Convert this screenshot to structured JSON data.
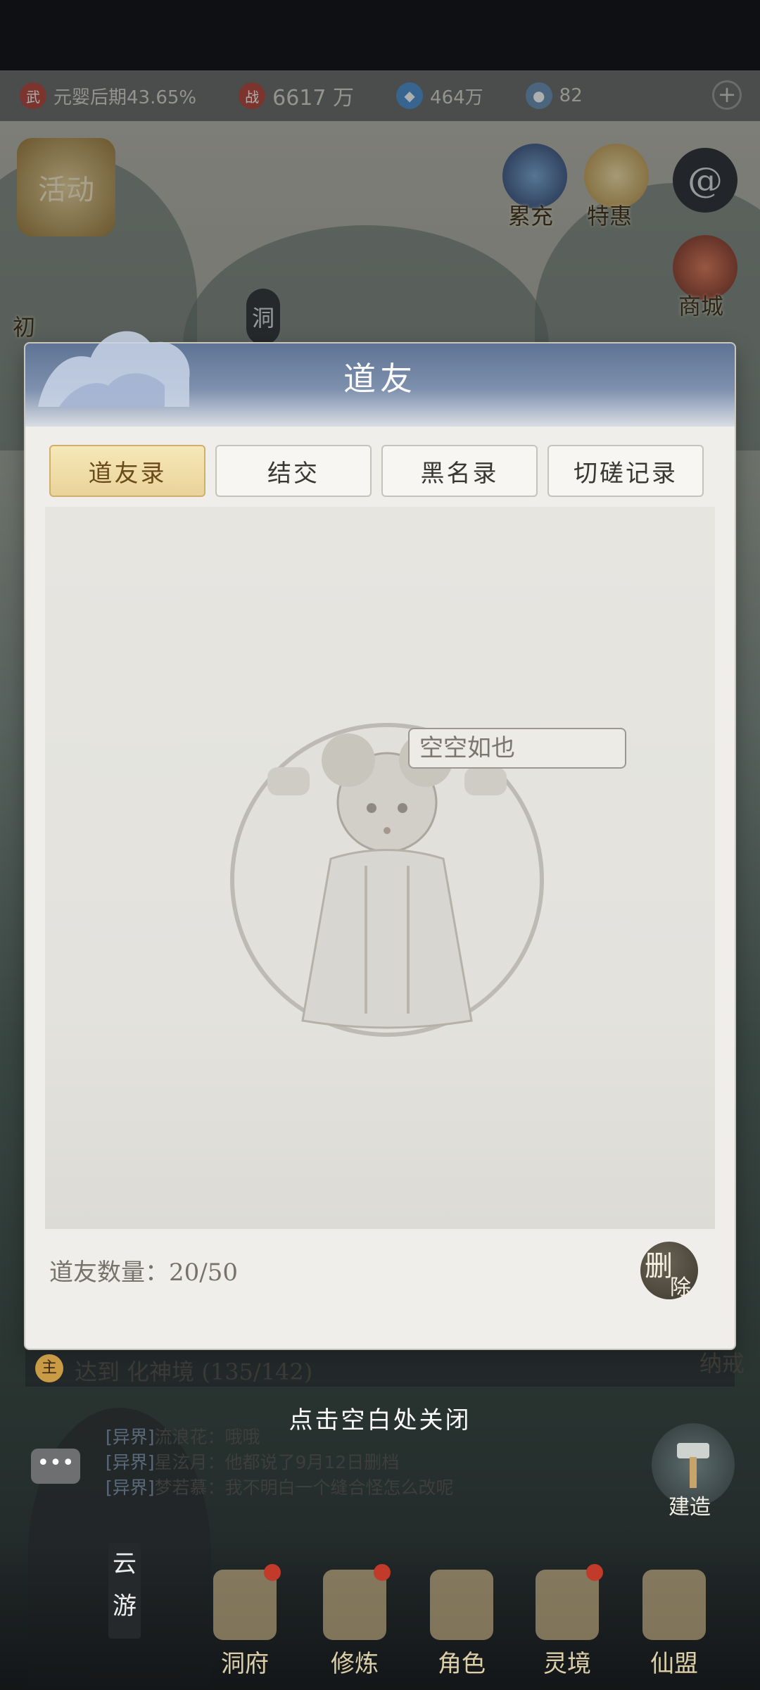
{
  "resources": [
    {
      "icon": "cultivation-icon",
      "glyph": "武",
      "color": "#b2453a",
      "text": "元婴后期43.65%"
    },
    {
      "icon": "combat-power-icon",
      "glyph": "战",
      "color": "#b2453a",
      "text": "6617 万"
    },
    {
      "icon": "spirit-stone-icon",
      "glyph": "◆",
      "color": "#4b8fd0",
      "text": "464万"
    },
    {
      "icon": "gem-icon",
      "glyph": "●",
      "color": "#6a8fb5",
      "text": "82"
    }
  ],
  "side_buttons": {
    "activity": "活动",
    "recharge": "累充",
    "special_offer": "特惠",
    "shop": "商城",
    "first_charge": "初",
    "cave_tag": "洞"
  },
  "modal": {
    "title": "道友",
    "tabs": [
      {
        "label": "道友录",
        "active": true
      },
      {
        "label": "结交",
        "active": false
      },
      {
        "label": "黑名录",
        "active": false
      },
      {
        "label": "切磋记录",
        "active": false
      }
    ],
    "empty_message": "空空如也",
    "friend_count_label": "道友数量：20/50",
    "delete_label_1": "删",
    "delete_label_2": "除"
  },
  "quest": {
    "icon_glyph": "主",
    "text": "达到 化神境 (135/142)"
  },
  "storage_label": "纳戒",
  "close_hint": "点击空白处关闭",
  "chat": {
    "button_glyph": "•••",
    "lines": [
      {
        "tag": "[异界]",
        "text": "流浪花：哦哦"
      },
      {
        "tag": "[异界]",
        "text": "星泫月：他都说了9月12日删档"
      },
      {
        "tag": "[异界]",
        "text": "梦若慕：我不明白一个缝合怪怎么改呢"
      }
    ]
  },
  "build_label": "建造",
  "yunyou_label": "云游",
  "bottom_nav": [
    {
      "label": "洞府",
      "has_dot": true
    },
    {
      "label": "修炼",
      "has_dot": true
    },
    {
      "label": "角色",
      "has_dot": false
    },
    {
      "label": "灵境",
      "has_dot": true
    },
    {
      "label": "仙盟",
      "has_dot": false
    }
  ]
}
